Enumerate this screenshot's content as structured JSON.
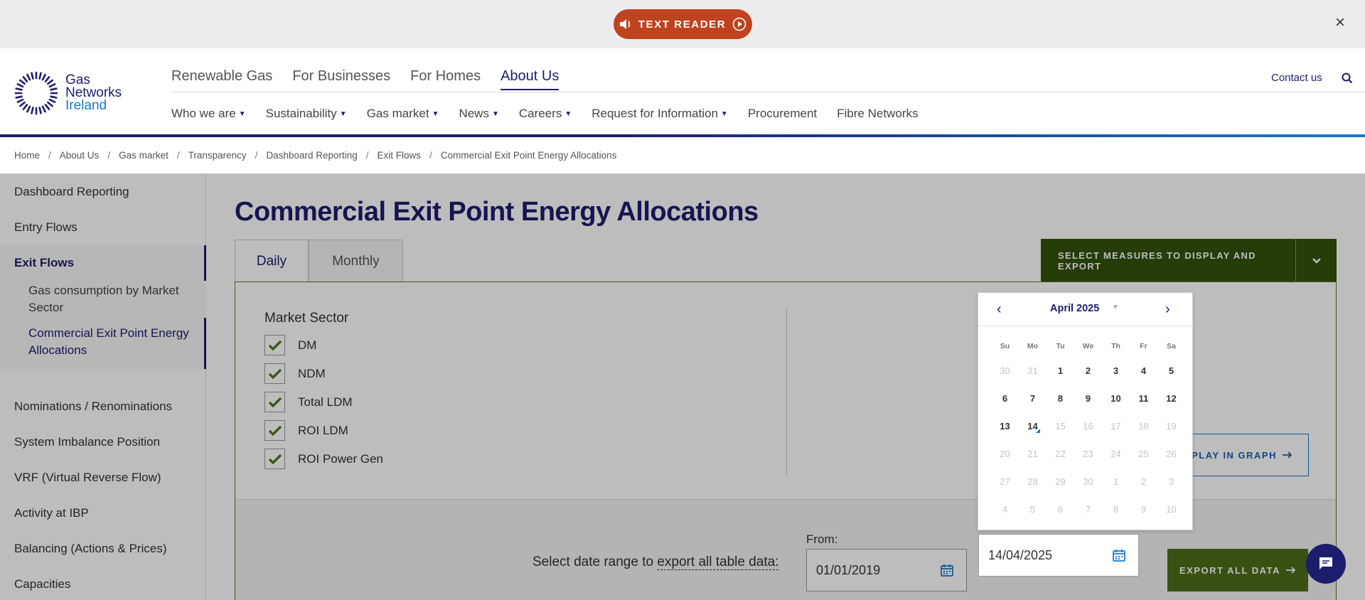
{
  "topbar": {
    "text_reader_label": "TEXT READER",
    "close_label": "×"
  },
  "logo": {
    "line1": "Gas",
    "line2": "Networks",
    "line3": "Ireland"
  },
  "main_nav": [
    "Renewable Gas",
    "For Businesses",
    "For Homes",
    "About Us"
  ],
  "main_nav_active": "About Us",
  "contact_label": "Contact us",
  "sub_nav": [
    {
      "label": "Who we are",
      "dropdown": true
    },
    {
      "label": "Sustainability",
      "dropdown": true
    },
    {
      "label": "Gas market",
      "dropdown": true
    },
    {
      "label": "News",
      "dropdown": true
    },
    {
      "label": "Careers",
      "dropdown": true
    },
    {
      "label": "Request for Information",
      "dropdown": true
    },
    {
      "label": "Procurement",
      "dropdown": false
    },
    {
      "label": "Fibre Networks",
      "dropdown": false
    }
  ],
  "breadcrumb": [
    "Home",
    "About Us",
    "Gas market",
    "Transparency",
    "Dashboard Reporting",
    "Exit Flows",
    "Commercial Exit Point Energy Allocations"
  ],
  "sidebar": {
    "items": [
      "Dashboard Reporting",
      "Entry Flows",
      "Exit Flows",
      "Gas consumption by Market Sector",
      "Commercial Exit Point Energy Allocations",
      "Nominations / Renominations",
      "System Imbalance Position",
      "VRF (Virtual Reverse Flow)",
      "Activity at IBP",
      "Balancing (Actions & Prices)",
      "Capacities"
    ]
  },
  "page_title": "Commercial Exit Point Energy Allocations",
  "tabs": [
    "Daily",
    "Monthly"
  ],
  "measures_button": "SELECT MEASURES TO DISPLAY AND EXPORT",
  "market_sector": {
    "title": "Market Sector",
    "options": [
      "DM",
      "NDM",
      "Total LDM",
      "ROI LDM",
      "ROI Power Gen"
    ]
  },
  "graph_button": "SPLAY IN GRAPH",
  "export": {
    "label_prefix": "Select date range to",
    "label_link": "export all table data:",
    "from_label": "From:",
    "from_value": "01/01/2019",
    "to_value": "14/04/2025",
    "button": "EXPORT ALL DATA"
  },
  "datepicker": {
    "month_label": "April 2025",
    "prev": "‹",
    "next": "›",
    "weekdays": [
      "Su",
      "Mo",
      "Tu",
      "We",
      "Th",
      "Fr",
      "Sa"
    ],
    "weeks": [
      [
        "30",
        "31",
        "1",
        "2",
        "3",
        "4",
        "5"
      ],
      [
        "6",
        "7",
        "8",
        "9",
        "10",
        "11",
        "12"
      ],
      [
        "13",
        "14",
        "15",
        "16",
        "17",
        "18",
        "19"
      ],
      [
        "20",
        "21",
        "22",
        "23",
        "24",
        "25",
        "26"
      ],
      [
        "27",
        "28",
        "29",
        "30",
        "1",
        "2",
        "3"
      ],
      [
        "4",
        "5",
        "6",
        "7",
        "8",
        "9",
        "10"
      ]
    ],
    "today": "14"
  },
  "colors": {
    "brand_navy": "#1d1d6e",
    "brand_blue": "#1a7ad0",
    "text_reader": "#c0431f",
    "export_green": "#4e6e19",
    "measures_green": "#34520d",
    "checkmark_green": "#4e7a1e"
  },
  "icons": {
    "close": "close-icon",
    "search": "search-icon",
    "speaker": "speaker-icon",
    "play": "play-circle-icon",
    "calendar": "calendar-icon",
    "chat": "chat-icon",
    "arrow": "arrow-right-icon"
  }
}
